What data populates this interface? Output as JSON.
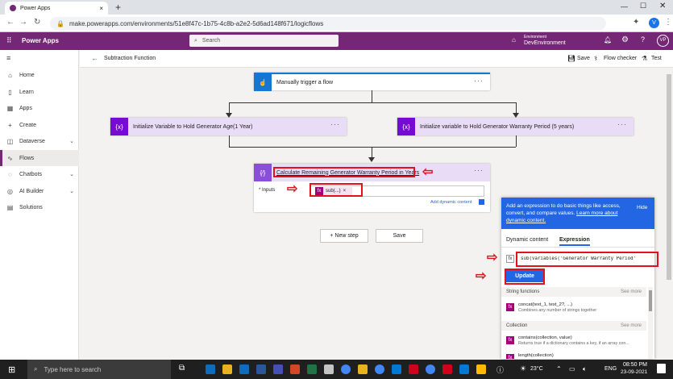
{
  "browser": {
    "tab_title": "Power Apps",
    "new_tab": "+",
    "url": "make.powerapps.com/environments/51e8f47c-1b75-4c8b-a2e2-5d6ad148f671/logicflows",
    "profile_initial": "V"
  },
  "app": {
    "name": "Power Apps",
    "search_placeholder": "Search",
    "environment_label": "Environment",
    "environment_name": "DevEnvironment",
    "avatar_initials": "VP"
  },
  "nav": {
    "items": [
      {
        "label": "Home",
        "icon": "home-icon"
      },
      {
        "label": "Learn",
        "icon": "book-icon"
      },
      {
        "label": "Apps",
        "icon": "apps-icon"
      },
      {
        "label": "Create",
        "icon": "plus-icon"
      },
      {
        "label": "Dataverse",
        "icon": "database-icon"
      },
      {
        "label": "Flows",
        "icon": "flow-icon"
      },
      {
        "label": "Chatbots",
        "icon": "chatbot-icon"
      },
      {
        "label": "AI Builder",
        "icon": "ai-icon"
      },
      {
        "label": "Solutions",
        "icon": "solutions-icon"
      }
    ]
  },
  "command": {
    "flow_name": "Subtraction Function",
    "save": "Save",
    "flow_checker": "Flow checker",
    "test": "Test"
  },
  "flow": {
    "trigger": "Manually trigger a flow",
    "init1": "Initialize Variable to Hold Generator Age(1 Year)",
    "init2": "Initialize variable to Hold Generator Warranty Period (5 years)",
    "compose_title": "Calculate Remaining Generator Warranty Period in Years",
    "inputs_label": "* Inputs",
    "token_label": "sub(...)",
    "token_close": "×",
    "add_dynamic": "Add dynamic content",
    "new_step": "+ New step",
    "save_button": "Save"
  },
  "panel": {
    "info_text": "Add an expression to do basic things like access, convert, and compare values.",
    "learn_more": "Learn more about dynamic content.",
    "hide": "Hide",
    "tab_dynamic": "Dynamic content",
    "tab_expression": "Expression",
    "expression_value": "sub(variables('Generator Warranty Period'",
    "update": "Update",
    "section_string": "String functions",
    "see_more_1": "See more",
    "fn1_name": "concat(text_1, text_2?, ...)",
    "fn1_desc": "Combines any number of strings together",
    "section_collection": "Collection",
    "see_more_2": "See more",
    "fn2_name": "contains(collection, value)",
    "fn2_desc": "Returns true if a dictionary contains a key, if an array con...",
    "fn3_name": "length(collection)"
  },
  "taskbar": {
    "search_placeholder": "Type here to search",
    "weather": "23°C",
    "language": "ENG",
    "time": "08:50 PM",
    "date": "23-09-2021"
  },
  "colors": {
    "brand": "#742774",
    "trigger_blue": "#1677d2",
    "variable_purple": "#770bd6",
    "highlight_red": "#e3101d",
    "update_blue": "#2266e3"
  }
}
